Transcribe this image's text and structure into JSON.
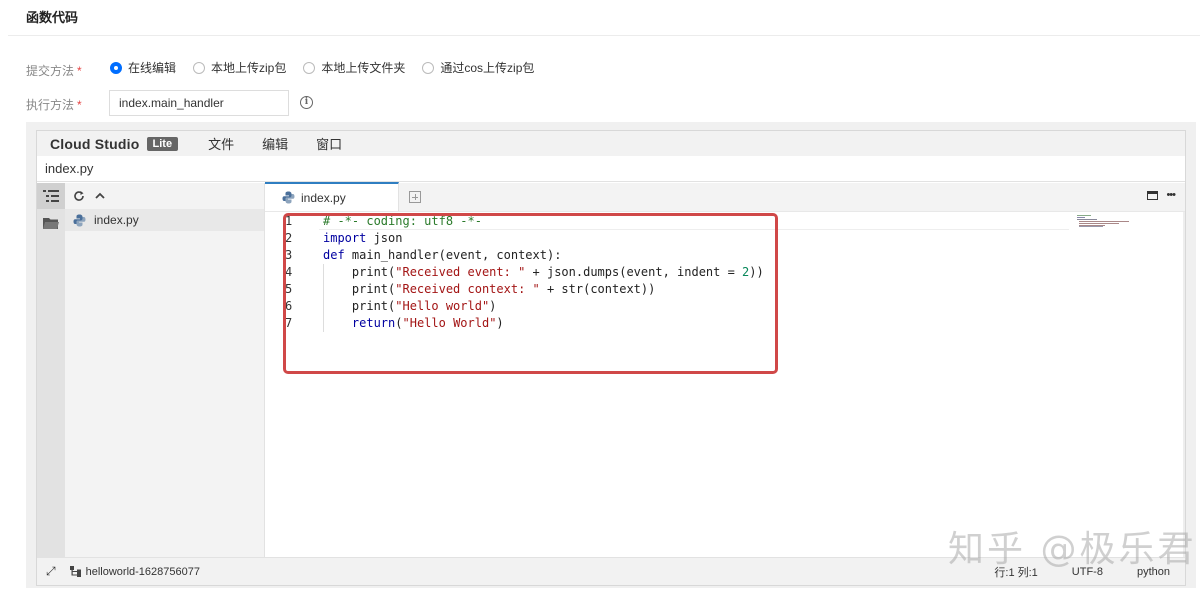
{
  "section": {
    "title": "函数代码"
  },
  "form": {
    "submit_label": "提交方法",
    "required_mark": "*",
    "submit_options": [
      {
        "label": "在线编辑",
        "checked": true
      },
      {
        "label": "本地上传zip包",
        "checked": false
      },
      {
        "label": "本地上传文件夹",
        "checked": false
      },
      {
        "label": "通过cos上传zip包",
        "checked": false
      }
    ],
    "handler_label": "执行方法",
    "handler_value": "index.main_handler",
    "info_glyph": "i"
  },
  "ide": {
    "brand": "Cloud Studio",
    "edition": "Lite",
    "menu": [
      "文件",
      "编辑",
      "窗口"
    ],
    "path": "index.py",
    "explorer_file": "index.py",
    "tab_label": "index.py",
    "code": [
      {
        "n": "1",
        "html": "<span class=\"cm\"># -*- coding: utf8 -*-</span>"
      },
      {
        "n": "2",
        "html": "<span class=\"kw\">import</span> json"
      },
      {
        "n": "3",
        "html": "<span class=\"kw\">def</span> main_handler(event, context):"
      },
      {
        "n": "4",
        "html": "    print(<span class=\"str\">\"Received event: \"</span> + json.dumps(event, indent = <span class=\"num\">2</span>))"
      },
      {
        "n": "5",
        "html": "    print(<span class=\"str\">\"Received context: \"</span> + str(context))"
      },
      {
        "n": "6",
        "html": "    print(<span class=\"str\">\"Hello world\"</span>)"
      },
      {
        "n": "7",
        "html": "    <span class=\"kw\">return</span>(<span class=\"str\">\"Hello World\"</span>)"
      }
    ],
    "status": {
      "project": "helloworld-1628756077",
      "position": "行:1 列:1",
      "encoding": "UTF-8",
      "language": "python"
    }
  },
  "watermark": "知乎 @极乐君",
  "colors": {
    "accent": "#006eff",
    "highlight_box": "#d04848",
    "tab_border": "#2f7ec1"
  }
}
